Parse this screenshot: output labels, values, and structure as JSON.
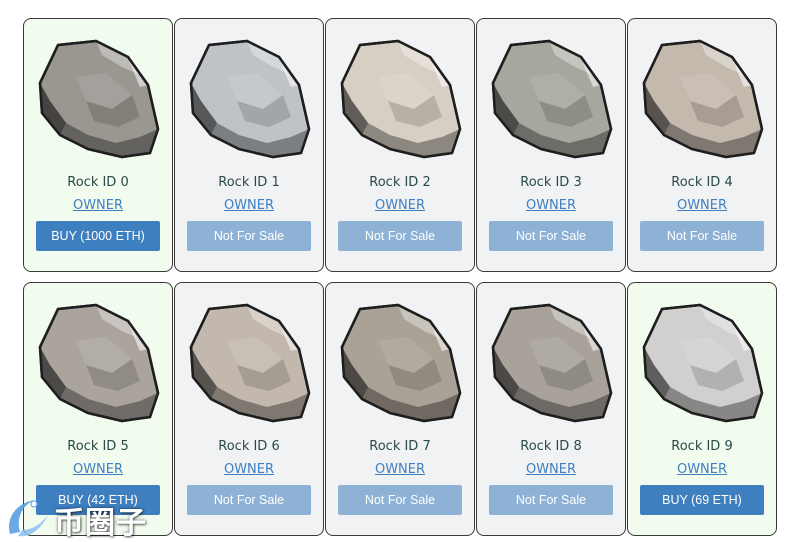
{
  "rocks": [
    {
      "id_label": "Rock ID 0",
      "owner_label": "OWNER",
      "button_label": "BUY (1000 ETH)",
      "for_sale": true,
      "tone": "#9a9690"
    },
    {
      "id_label": "Rock ID 1",
      "owner_label": "OWNER",
      "button_label": "Not For Sale",
      "for_sale": false,
      "tone": "#bfc3c8"
    },
    {
      "id_label": "Rock ID 2",
      "owner_label": "OWNER",
      "button_label": "Not For Sale",
      "for_sale": false,
      "tone": "#d8cfc4"
    },
    {
      "id_label": "Rock ID 3",
      "owner_label": "OWNER",
      "button_label": "Not For Sale",
      "for_sale": false,
      "tone": "#a6a79e"
    },
    {
      "id_label": "Rock ID 4",
      "owner_label": "OWNER",
      "button_label": "Not For Sale",
      "for_sale": false,
      "tone": "#c4b9ad"
    },
    {
      "id_label": "Rock ID 5",
      "owner_label": "OWNER",
      "button_label": "BUY (42 ETH)",
      "for_sale": true,
      "tone": "#aaa49d"
    },
    {
      "id_label": "Rock ID 6",
      "owner_label": "OWNER",
      "button_label": "Not For Sale",
      "for_sale": false,
      "tone": "#c2b8ae"
    },
    {
      "id_label": "Rock ID 7",
      "owner_label": "OWNER",
      "button_label": "Not For Sale",
      "for_sale": false,
      "tone": "#aaa296"
    },
    {
      "id_label": "Rock ID 8",
      "owner_label": "OWNER",
      "button_label": "Not For Sale",
      "for_sale": false,
      "tone": "#a8a29b"
    },
    {
      "id_label": "Rock ID 9",
      "owner_label": "OWNER",
      "button_label": "BUY (69 ETH)",
      "for_sale": true,
      "tone": "#d2d0ce"
    }
  ],
  "colors": {
    "card_for_sale_bg": "#f1fcee",
    "card_not_for_sale_bg": "#f1f2f4",
    "buy_button": "#3d7fbf",
    "not_for_sale_button": "#8db2d6",
    "owner_link": "#3f7fbf"
  },
  "watermark": {
    "text": "币圈子",
    "icon": "swoosh-logo-icon"
  }
}
